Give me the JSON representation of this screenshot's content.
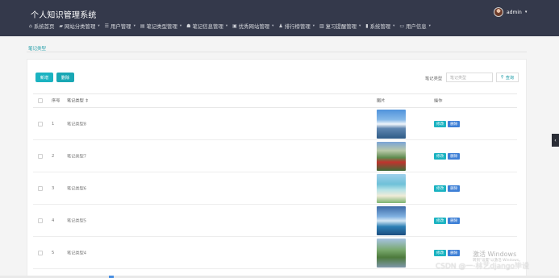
{
  "app": {
    "title": "个人知识管理系统"
  },
  "user": {
    "name": "admin"
  },
  "nav": [
    {
      "label": "系统首页",
      "icon": "home-icon",
      "glyph": "⌂",
      "has_arrow": false
    },
    {
      "label": "网站分类管理",
      "icon": "folder-icon",
      "glyph": "▰",
      "has_arrow": true
    },
    {
      "label": "用户管理",
      "icon": "list-icon",
      "glyph": "☰",
      "has_arrow": true
    },
    {
      "label": "笔记类型管理",
      "icon": "notebook-icon",
      "glyph": "▤",
      "has_arrow": true
    },
    {
      "label": "笔记信息管理",
      "icon": "note-icon",
      "glyph": "☗",
      "has_arrow": true
    },
    {
      "label": "优秀网站管理",
      "icon": "website-icon",
      "glyph": "▣",
      "has_arrow": true
    },
    {
      "label": "排行榜管理",
      "icon": "user-icon",
      "glyph": "♟",
      "has_arrow": true
    },
    {
      "label": "复习提醒管理",
      "icon": "reminder-icon",
      "glyph": "▥",
      "has_arrow": true
    },
    {
      "label": "系统管理",
      "icon": "bar-chart-icon",
      "glyph": "▮",
      "has_arrow": true
    },
    {
      "label": "用户信息",
      "icon": "user-card-icon",
      "glyph": "▭",
      "has_arrow": true
    }
  ],
  "breadcrumb": "笔记类型",
  "toolbar": {
    "add_label": "新增",
    "delete_label": "删除"
  },
  "search": {
    "label": "笔记类型",
    "placeholder": "笔记类型",
    "button_label": "查询"
  },
  "table": {
    "headers": {
      "index": "序号",
      "name": "笔记类型",
      "image": "图片",
      "action": "操作"
    },
    "sort_icon": "⇕",
    "rows": [
      {
        "index": "1",
        "name": "笔记类型8"
      },
      {
        "index": "2",
        "name": "笔记类型7"
      },
      {
        "index": "3",
        "name": "笔记类型6"
      },
      {
        "index": "4",
        "name": "笔记类型5"
      },
      {
        "index": "5",
        "name": "笔记类型4"
      }
    ],
    "edit_label": "修改",
    "remove_label": "删除"
  },
  "watermark": {
    "title": "激活 Windows",
    "subtitle": "转到\"设置\"以激活 Windows。"
  },
  "csdn": "CSDN @一·林艺django毕设"
}
